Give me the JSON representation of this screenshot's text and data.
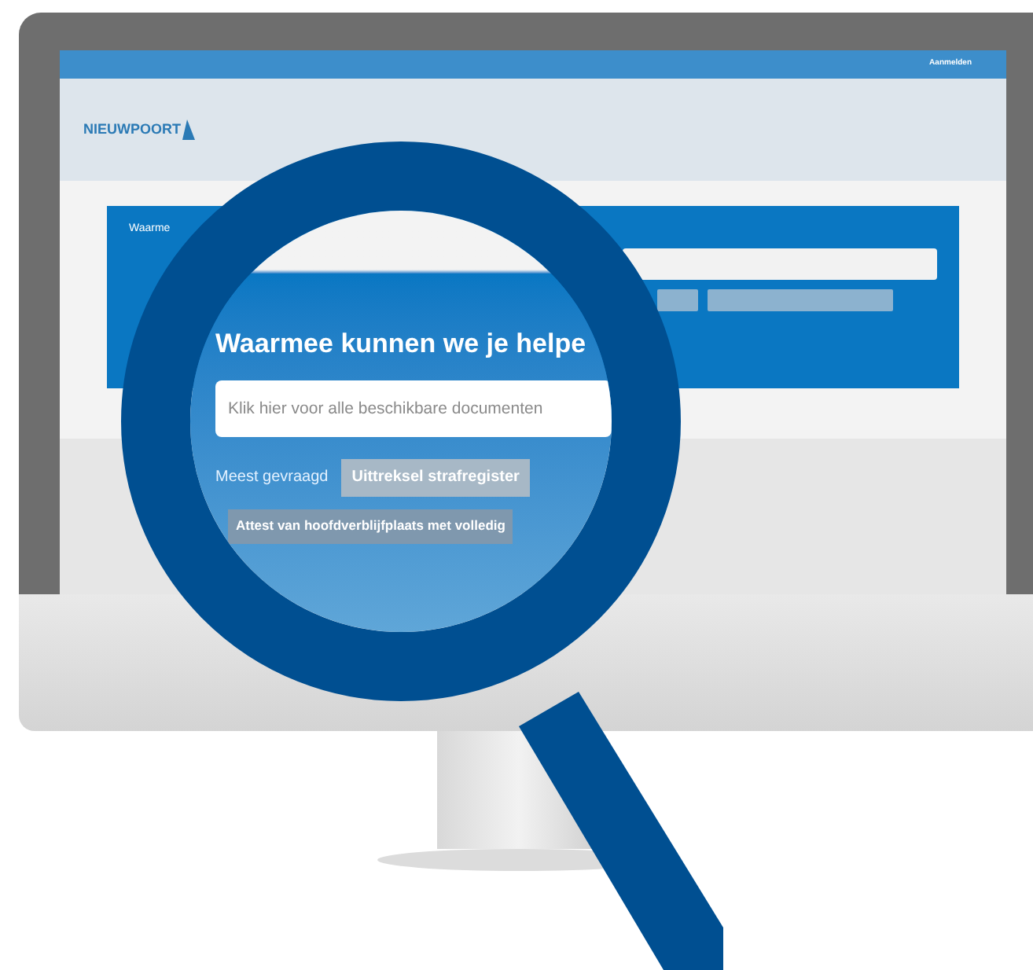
{
  "top_bar": {
    "login_link": "Aanmelden"
  },
  "header": {
    "logo": "NIEUWPOORT"
  },
  "search_panel": {
    "label": "Waarme"
  },
  "magnifier": {
    "heading": "Waarmee kunnen we je helpe",
    "search_field": {
      "placeholder": "Klik hier voor alle beschikbare documenten"
    },
    "most_requested_label": "Meest gevraagd",
    "quick_links": [
      "Uittreksel strafregister",
      "Attest van hoofdverblijfplaats met volledig"
    ]
  }
}
